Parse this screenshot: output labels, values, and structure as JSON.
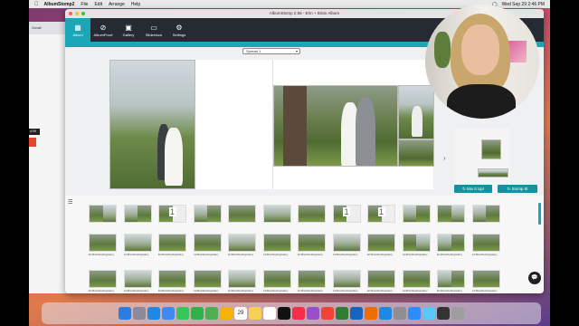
{
  "menubar": {
    "app": "AlbumStomp2",
    "items": [
      "File",
      "Edit",
      "Arrange",
      "Help"
    ],
    "clock": "Wed Sep 29 2:46 PM"
  },
  "browser": {
    "tab": "Gmail",
    "side_label": "4:09"
  },
  "window": {
    "title": "AlbumStomp 2.55 - Erin + Brian Album"
  },
  "toolbar": [
    {
      "label": "Album",
      "icon": "▦",
      "active": true
    },
    {
      "label": "AlbumProof",
      "icon": "⊘",
      "active": false
    },
    {
      "label": "Gallery",
      "icon": "▣",
      "active": false
    },
    {
      "label": "Slideshow",
      "icon": "▭",
      "active": false
    },
    {
      "label": "Settings",
      "icon": "⚙",
      "active": false
    }
  ],
  "spread_select": {
    "value": "Spread 1"
  },
  "actions": {
    "mix": "Mix It Up!",
    "stomp": "Stomp It!"
  },
  "thumb_caption": "ErinBrianWeddingGallery",
  "strip_rows": [
    [
      {
        "l": "park",
        "r": "sky"
      },
      {
        "l": "sky",
        "r": "park"
      },
      {
        "l": "park",
        "num": "1"
      },
      {
        "l": "sky",
        "r": "park"
      },
      {
        "l": "park",
        "r": "park"
      },
      {
        "l": "sky",
        "r": "sky"
      },
      {
        "l": "park",
        "r": "park"
      },
      {
        "l": "park",
        "num": "1"
      },
      {
        "l": "park",
        "num": "1"
      },
      {
        "l": "sky",
        "r": "park"
      },
      {
        "l": "park",
        "r": "sky"
      },
      {
        "l": "sky",
        "r": "park"
      }
    ],
    [
      {
        "l": "park",
        "r": "park"
      },
      {
        "l": "sky",
        "r": "sky"
      },
      {
        "l": "park",
        "r": "park"
      },
      {
        "l": "park",
        "r": "park"
      },
      {
        "l": "sky",
        "r": "sky"
      },
      {
        "l": "park",
        "r": "park"
      },
      {
        "l": "park",
        "r": "park"
      },
      {
        "l": "sky",
        "r": "sky"
      },
      {
        "l": "park",
        "r": "park"
      },
      {
        "l": "park",
        "r": "sky"
      },
      {
        "l": "sky",
        "r": "park"
      },
      {
        "l": "park",
        "r": "park"
      }
    ],
    [
      {
        "l": "park",
        "r": "park"
      },
      {
        "l": "sky",
        "r": "sky"
      },
      {
        "l": "park",
        "r": "park"
      },
      {
        "l": "park",
        "r": "park"
      },
      {
        "l": "sky",
        "r": "sky"
      },
      {
        "l": "park",
        "r": "park"
      },
      {
        "l": "park",
        "r": "park"
      },
      {
        "l": "sky",
        "r": "sky"
      },
      {
        "l": "park",
        "r": "park"
      },
      {
        "l": "park",
        "r": "park"
      },
      {
        "l": "sky",
        "r": "park"
      },
      {
        "l": "park",
        "r": "park"
      }
    ]
  ],
  "dock": {
    "icons": [
      "finder",
      "launchpad",
      "safari",
      "mail",
      "messages",
      "facetime",
      "maps",
      "photos",
      "calendar",
      "notes",
      "reminders",
      "appletv",
      "music",
      "podcasts",
      "news",
      "numbers",
      "keynote",
      "pages",
      "appstore",
      "settings",
      "zoom",
      "preview",
      "quicktime",
      "trash"
    ],
    "calendar_day": "29"
  },
  "colors": {
    "teal": "#1aa6b7",
    "toolbar": "#262b33",
    "button": "#1b8fa0"
  }
}
